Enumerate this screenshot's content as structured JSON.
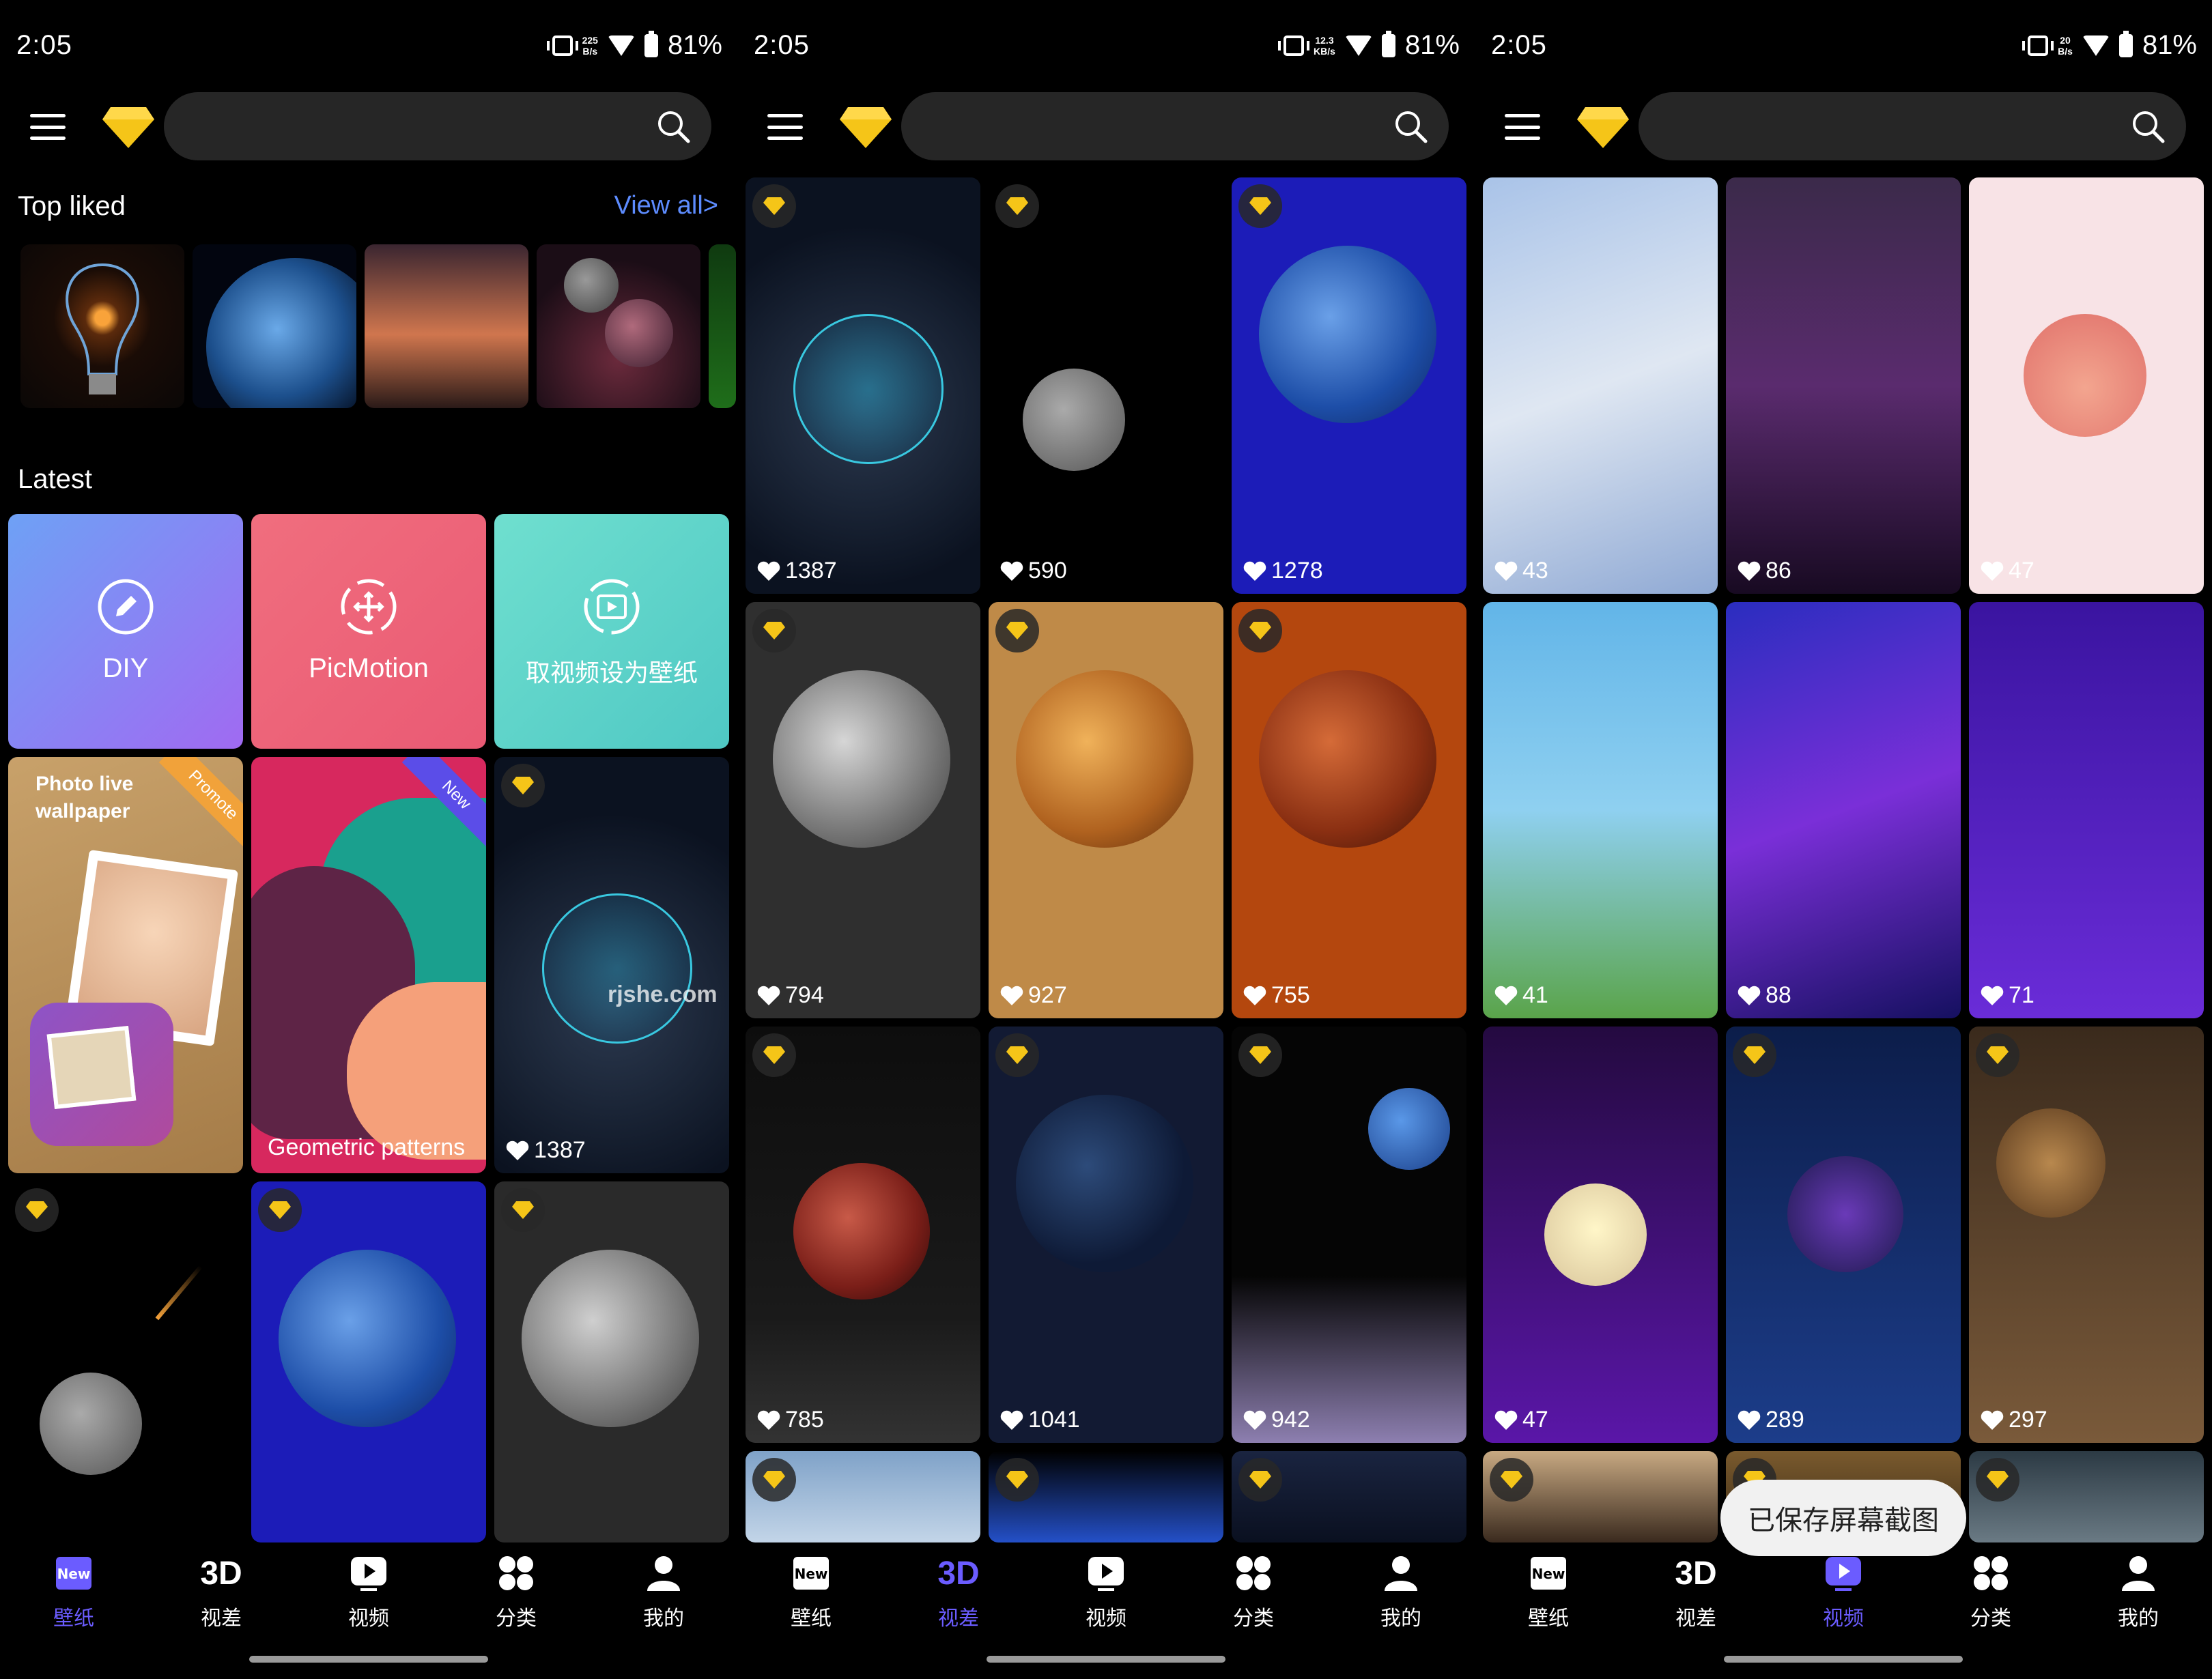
{
  "status": {
    "time": "2:05",
    "battery": "81%",
    "net_speeds": [
      {
        "value": "225",
        "unit": "B/s"
      },
      {
        "value": "12.3",
        "unit": "KB/s"
      },
      {
        "value": "20",
        "unit": "B/s"
      }
    ]
  },
  "search": {
    "placeholder": ""
  },
  "home": {
    "top_liked_title": "Top liked",
    "view_all": "View all>",
    "latest_title": "Latest",
    "features": [
      {
        "label": "DIY",
        "icon": "pencil-icon",
        "color": "#8a7cf5"
      },
      {
        "label": "PicMotion",
        "icon": "move-icon",
        "color": "#ef6b7c"
      },
      {
        "label": "取视频设为壁纸",
        "icon": "video-icon",
        "color": "#5ed9c6"
      }
    ],
    "promo": {
      "title": "Photo live wallpaper",
      "ribbon": "Promote"
    },
    "geometric": {
      "label": "Geometric patterns",
      "ribbon": "New"
    },
    "latest_likes": "1387"
  },
  "parallax_likes": [
    "1387",
    "590",
    "1278",
    "794",
    "927",
    "755",
    "785",
    "1041",
    "942"
  ],
  "video_likes": [
    "43",
    "86",
    "47",
    "41",
    "88",
    "71",
    "47",
    "289",
    "297"
  ],
  "nav": [
    {
      "label": "壁纸",
      "icon": "new-wallpaper-icon"
    },
    {
      "label": "视差",
      "icon": "3d-icon"
    },
    {
      "label": "视频",
      "icon": "play-icon"
    },
    {
      "label": "分类",
      "icon": "categories-icon"
    },
    {
      "label": "我的",
      "icon": "profile-icon"
    }
  ],
  "toast": "已保存屏幕截图",
  "watermark": "rjshe.com",
  "colors": {
    "accent": "#6b5cff",
    "link": "#5d8cff",
    "gem": "#f5c518",
    "search_bg": "#262626"
  }
}
